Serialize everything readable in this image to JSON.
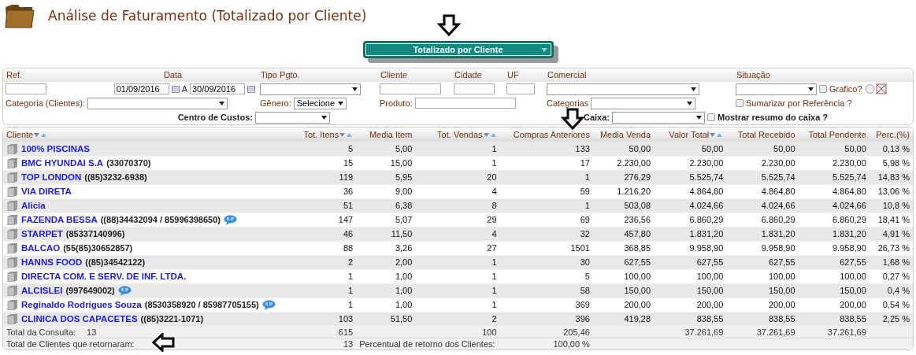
{
  "title": "Análise de Faturamento (Totalizado por Cliente)",
  "view_select": {
    "value": "Totalizado por Cliente"
  },
  "filters": {
    "ref": {
      "label": "Ref."
    },
    "data": {
      "label": "Data",
      "from": "01/09/2016",
      "separator": "A",
      "to": "30/09/2016"
    },
    "tipo_pgto": {
      "label": "Tipo Pgto."
    },
    "cliente": {
      "label": "Cliente"
    },
    "cidade": {
      "label": "Cidade"
    },
    "uf": {
      "label": "UF"
    },
    "comercial": {
      "label": "Comercial"
    },
    "situacao": {
      "label": "Situação"
    },
    "grafico": {
      "label": "Grafico?",
      "checked": false
    },
    "categoria_clientes": {
      "label": "Categoria (Clientes):"
    },
    "genero": {
      "label": "Gênero:",
      "value": "Selecione"
    },
    "produto": {
      "label": "Produto:"
    },
    "categorias": {
      "label": "Categorias"
    },
    "sumarizar": {
      "label": "Sumarizar por Referência ?",
      "checked": false
    },
    "centro_custos": {
      "label": "Centro de Custos:"
    },
    "caixa": {
      "label": "Caixa:"
    },
    "mostrar_resumo": {
      "label": "Mostrar resumo do caixa ?",
      "checked": false
    }
  },
  "table": {
    "columns": [
      {
        "label": "Cliente",
        "sortable": true
      },
      {
        "label": "Tot. Itens",
        "sortable": true
      },
      {
        "label": "Media Item",
        "sortable": false
      },
      {
        "label": "Tot. Vendas",
        "sortable": true
      },
      {
        "label": "Compras Anteriores",
        "sortable": false
      },
      {
        "label": "Media Venda",
        "sortable": false
      },
      {
        "label": "Valor Total",
        "sortable": true
      },
      {
        "label": "Total Recebido",
        "sortable": false
      },
      {
        "label": "Total Pendente",
        "sortable": false
      },
      {
        "label": "Perc.(%)",
        "sortable": false
      }
    ],
    "rows": [
      {
        "name": "100% PISCINAS",
        "sms": false,
        "values": [
          "5",
          "5,00",
          "1",
          "133",
          "50,00",
          "50,00",
          "50,00",
          "50,00",
          "0,13 %"
        ]
      },
      {
        "name": "BMC HYUNDAI S.A",
        "phone": "(33070370)",
        "sms": false,
        "values": [
          "15",
          "15,00",
          "1",
          "17",
          "2.230,00",
          "2.230,00",
          "2.230,00",
          "2.230,00",
          "5,98 %"
        ]
      },
      {
        "name": "TOP LONDON",
        "phone": "((85)3232-6938)",
        "sms": false,
        "values": [
          "119",
          "5,95",
          "20",
          "1",
          "276,29",
          "5.525,74",
          "5.525,74",
          "5.525,74",
          "14,83 %"
        ]
      },
      {
        "name": "VIA DIRETA",
        "sms": false,
        "values": [
          "36",
          "9,00",
          "4",
          "59",
          "1.216,20",
          "4.864,80",
          "4.864,80",
          "4.864,80",
          "13,06 %"
        ]
      },
      {
        "name": "Alicia",
        "sms": false,
        "values": [
          "51",
          "6,38",
          "8",
          "1",
          "503,08",
          "4.024,66",
          "4.024,66",
          "4.024,66",
          "10,8 %"
        ]
      },
      {
        "name": "FAZENDA BESSA",
        "phone": "((88)34432094 / 85996398650)",
        "sms": true,
        "values": [
          "147",
          "5,07",
          "29",
          "69",
          "236,56",
          "6.860,29",
          "6.860,29",
          "6.860,29",
          "18,41 %"
        ]
      },
      {
        "name": "STARPET",
        "phone": "(85337140996)",
        "sms": false,
        "values": [
          "46",
          "11,50",
          "4",
          "32",
          "457,80",
          "1.831,20",
          "1.831,20",
          "1.831,20",
          "4,91 %"
        ]
      },
      {
        "name": "BALCAO",
        "phone": "(55(85)30652857)",
        "sms": false,
        "values": [
          "88",
          "3,26",
          "27",
          "1501",
          "368,85",
          "9.958,90",
          "9.958,90",
          "9.958,90",
          "26,73 %"
        ]
      },
      {
        "name": "HANNS FOOD",
        "phone": "((85)34542122)",
        "sms": false,
        "values": [
          "2",
          "2,00",
          "1",
          "30",
          "627,55",
          "627,55",
          "627,55",
          "627,55",
          "1,68 %"
        ]
      },
      {
        "name": "DIRECTA COM. E SERV. DE INF. LTDA.",
        "sms": false,
        "values": [
          "1",
          "1,00",
          "1",
          "5",
          "100,00",
          "100,00",
          "100,00",
          "100,00",
          "0,27 %"
        ]
      },
      {
        "name": "ALCISLEI",
        "phone": "(997649002)",
        "sms": true,
        "values": [
          "1",
          "1,00",
          "1",
          "58",
          "150,00",
          "150,00",
          "150,00",
          "150,00",
          "0,4 %"
        ]
      },
      {
        "name": "Reginaldo Rodrigues Souza",
        "phone": "(8530358920 / 85987705155)",
        "sms": true,
        "values": [
          "1",
          "1,00",
          "1",
          "369",
          "200,00",
          "200,00",
          "200,00",
          "200,00",
          "0,54 %"
        ]
      },
      {
        "name": "CLINICA DOS CAPACETES",
        "phone": "((85)3221-1071)",
        "sms": false,
        "values": [
          "103",
          "51,50",
          "2",
          "396",
          "419,28",
          "838,55",
          "838,55",
          "838,55",
          "2,25 %"
        ]
      }
    ],
    "totals": {
      "label": "Total da Consulta:",
      "count": "13",
      "tot_itens": "615",
      "tot_vendas": "100",
      "compras_anteriores": "205,46",
      "valor_total": "37.261,69",
      "total_recebido": "37.261,69",
      "total_pendente": "37.261,69"
    },
    "returning": {
      "label": "Total de Clientes que retornaram:",
      "count": "13",
      "percent_label": "Percentual de retorno dos Clientes:",
      "percent": "100,00 %"
    }
  }
}
